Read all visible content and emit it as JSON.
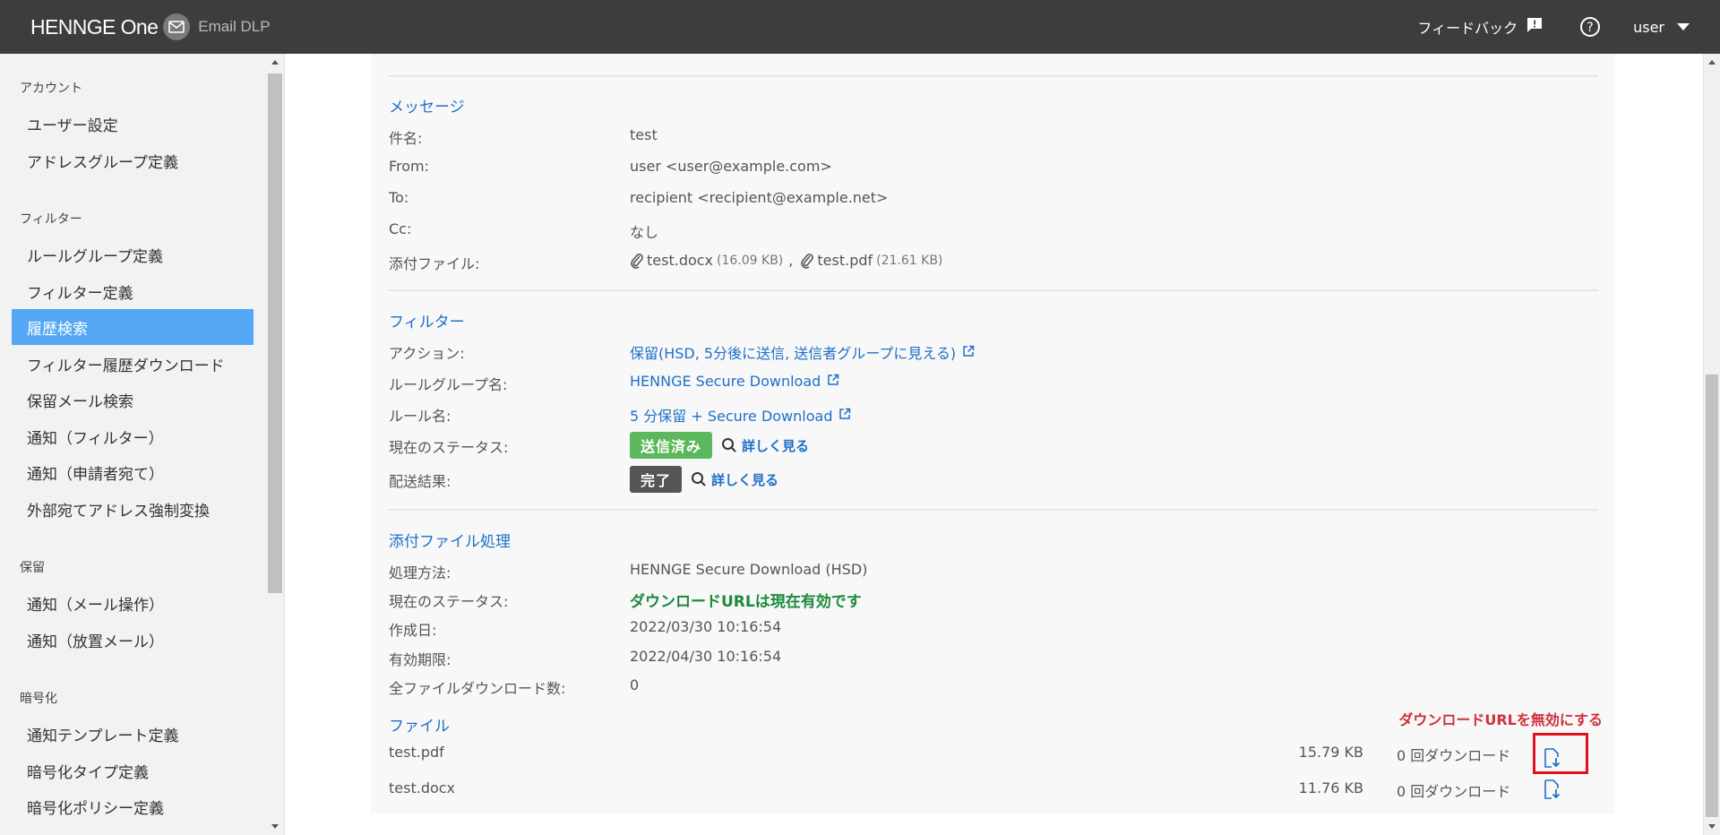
{
  "header": {
    "brand": "HENNGE One",
    "product": "Email DLP",
    "feedback": "フィードバック",
    "user": "user"
  },
  "sidebar": {
    "sections": [
      {
        "title": "アカウント",
        "items": [
          "ユーザー設定",
          "アドレスグループ定義"
        ]
      },
      {
        "title": "フィルター",
        "items": [
          "ルールグループ定義",
          "フィルター定義",
          "履歴検索",
          "フィルター履歴ダウンロード",
          "保留メール検索",
          "通知（フィルター）",
          "通知（申請者宛て）",
          "外部宛てアドレス強制変換"
        ]
      },
      {
        "title": "保留",
        "items": [
          "通知（メール操作）",
          "通知（放置メール）"
        ]
      },
      {
        "title": "暗号化",
        "items": [
          "通知テンプレート定義",
          "暗号化タイプ定義",
          "暗号化ポリシー定義"
        ]
      }
    ],
    "active": "履歴検索"
  },
  "message": {
    "title": "メッセージ",
    "subject_label": "件名:",
    "subject": "test",
    "from_label": "From:",
    "from": "user <user@example.com>",
    "to_label": "To:",
    "to": "recipient <recipient@example.net>",
    "cc_label": "Cc:",
    "cc": "なし",
    "attach_label": "添付ファイル:",
    "attachments": [
      {
        "name": "test.docx",
        "size": "(16.09 KB)"
      },
      {
        "name": "test.pdf",
        "size": "(21.61 KB)"
      }
    ],
    "attach_sep": ","
  },
  "filter": {
    "title": "フィルター",
    "action_label": "アクション:",
    "action": "保留(HSD, 5分後に送信, 送信者グループに見える)",
    "rulegroup_label": "ルールグループ名:",
    "rulegroup": "HENNGE Secure Download",
    "rule_label": "ルール名:",
    "rule": "5 分保留 + Secure Download",
    "status_label": "現在のステータス:",
    "status": "送信済み",
    "detail": "詳しく見る",
    "delivery_label": "配送結果:",
    "delivery": "完了"
  },
  "attachment_processing": {
    "title": "添付ファイル処理",
    "method_label": "処理方法:",
    "method": "HENNGE Secure Download (HSD)",
    "status_label": "現在のステータス:",
    "status": "ダウンロードURLは現在有効です",
    "created_label": "作成日:",
    "created": "2022/03/30 10:16:54",
    "expires_label": "有効期限:",
    "expires": "2022/04/30 10:16:54",
    "total_label": "全ファイルダウンロード数:",
    "total": "0"
  },
  "files": {
    "title": "ファイル",
    "disable_link": "ダウンロードURLを無効にする",
    "rows": [
      {
        "name": "test.pdf",
        "size": "15.79 KB",
        "downloads": "0 回ダウンロード"
      },
      {
        "name": "test.docx",
        "size": "11.76 KB",
        "downloads": "0 回ダウンロード"
      }
    ]
  },
  "colors": {
    "header_bg": "#3d3d3d",
    "sidebar_active": "#53a7f5",
    "link": "#1e70c8",
    "success": "#5cb85c",
    "valid_text": "#1c8a3c",
    "danger": "#d0303c"
  }
}
